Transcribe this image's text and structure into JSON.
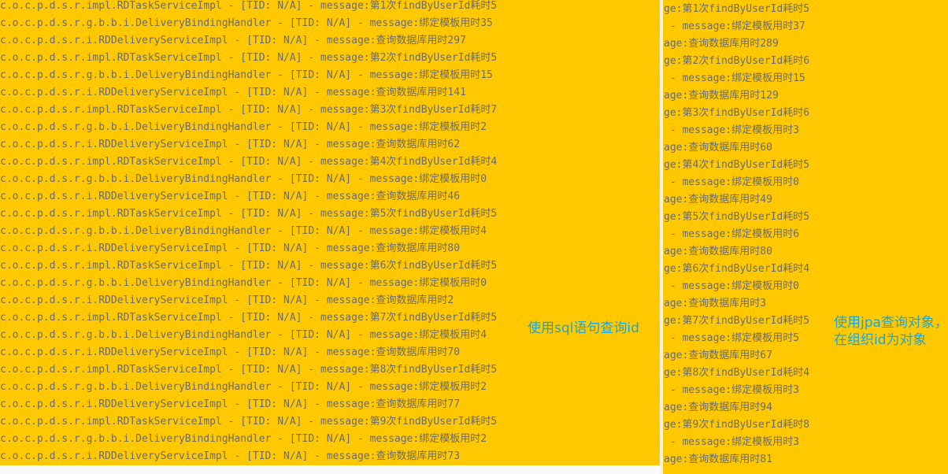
{
  "left_panel": {
    "lines": [
      "c.o.c.p.d.s.r.impl.RDTaskServiceImpl - [TID: N/A] - message:第1次findByUserId耗时5",
      "c.o.c.p.d.s.r.g.b.b.i.DeliveryBindingHandler - [TID: N/A] - message:绑定模板用时35",
      "c.o.c.p.d.s.r.i.RDDeliveryServiceImpl - [TID: N/A] - message:查询数据库用时297",
      "c.o.c.p.d.s.r.impl.RDTaskServiceImpl - [TID: N/A] - message:第2次findByUserId耗时5",
      "c.o.c.p.d.s.r.g.b.b.i.DeliveryBindingHandler - [TID: N/A] - message:绑定模板用时15",
      "c.o.c.p.d.s.r.i.RDDeliveryServiceImpl - [TID: N/A] - message:查询数据库用时141",
      "c.o.c.p.d.s.r.impl.RDTaskServiceImpl - [TID: N/A] - message:第3次findByUserId耗时7",
      "c.o.c.p.d.s.r.g.b.b.i.DeliveryBindingHandler - [TID: N/A] - message:绑定模板用时2",
      "c.o.c.p.d.s.r.i.RDDeliveryServiceImpl - [TID: N/A] - message:查询数据库用时62",
      "c.o.c.p.d.s.r.impl.RDTaskServiceImpl - [TID: N/A] - message:第4次findByUserId耗时4",
      "c.o.c.p.d.s.r.g.b.b.i.DeliveryBindingHandler - [TID: N/A] - message:绑定模板用时0",
      "c.o.c.p.d.s.r.i.RDDeliveryServiceImpl - [TID: N/A] - message:查询数据库用时46",
      "c.o.c.p.d.s.r.impl.RDTaskServiceImpl - [TID: N/A] - message:第5次findByUserId耗时5",
      "c.o.c.p.d.s.r.g.b.b.i.DeliveryBindingHandler - [TID: N/A] - message:绑定模板用时4",
      "c.o.c.p.d.s.r.i.RDDeliveryServiceImpl - [TID: N/A] - message:查询数据库用时80",
      "c.o.c.p.d.s.r.impl.RDTaskServiceImpl - [TID: N/A] - message:第6次findByUserId耗时5",
      "c.o.c.p.d.s.r.g.b.b.i.DeliveryBindingHandler - [TID: N/A] - message:绑定模板用时0",
      "c.o.c.p.d.s.r.i.RDDeliveryServiceImpl - [TID: N/A] - message:查询数据库用时2",
      "c.o.c.p.d.s.r.impl.RDTaskServiceImpl - [TID: N/A] - message:第7次findByUserId耗时5",
      "c.o.c.p.d.s.r.g.b.b.i.DeliveryBindingHandler - [TID: N/A] - message:绑定模板用时4",
      "c.o.c.p.d.s.r.i.RDDeliveryServiceImpl - [TID: N/A] - message:查询数据库用时70",
      "c.o.c.p.d.s.r.impl.RDTaskServiceImpl - [TID: N/A] - message:第8次findByUserId耗时5",
      "c.o.c.p.d.s.r.g.b.b.i.DeliveryBindingHandler - [TID: N/A] - message:绑定模板用时2",
      "c.o.c.p.d.s.r.i.RDDeliveryServiceImpl - [TID: N/A] - message:查询数据库用时77",
      "c.o.c.p.d.s.r.impl.RDTaskServiceImpl - [TID: N/A] - message:第9次findByUserId耗时5",
      "c.o.c.p.d.s.r.g.b.b.i.DeliveryBindingHandler - [TID: N/A] - message:绑定模板用时2",
      "c.o.c.p.d.s.r.i.RDDeliveryServiceImpl - [TID: N/A] - message:查询数据库用时73"
    ],
    "annotation": "使用sql语句查询id"
  },
  "right_panel": {
    "lines": [
      "ge:第1次findByUserId耗时5",
      " - message:绑定模板用时37",
      "age:查询数据库用时289",
      "ge:第2次findByUserId耗时6",
      " - message:绑定模板用时15",
      "age:查询数据库用时129",
      "ge:第3次findByUserId耗时6",
      " - message:绑定模板用时3",
      "age:查询数据库用时60",
      "ge:第4次findByUserId耗时5",
      " - message:绑定模板用时0",
      "age:查询数据库用时49",
      "ge:第5次findByUserId耗时5",
      " - message:绑定模板用时6",
      "age:查询数据库用时80",
      "ge:第6次findByUserId耗时4",
      " - message:绑定模板用时0",
      "age:查询数据库用时3",
      "ge:第7次findByUserId耗时5",
      " - message:绑定模板用时5",
      "age:查询数据库用时67",
      "ge:第8次findByUserId耗时4",
      " - message:绑定模板用时3",
      "age:查询数据库用时94",
      "ge:第9次findByUserId耗时8",
      " - message:绑定模板用时3",
      "age:查询数据库用时81"
    ],
    "annotation": "使用jpa查询对象，\n在组织id为对象"
  },
  "colors": {
    "panel_background": "#ffc800",
    "log_text": "#6b6b6b",
    "annotation_text": "#1ba7d6"
  }
}
